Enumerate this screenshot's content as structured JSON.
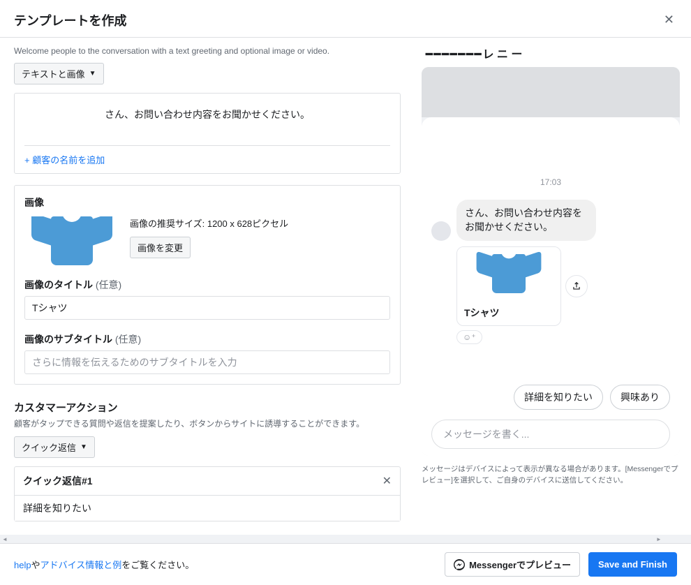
{
  "header": {
    "title": "テンプレートを作成"
  },
  "intro": "Welcome people to the conversation with a text greeting and optional image or video.",
  "contentTypeDropdown": "テキストと画像",
  "greeting": {
    "text": "さん、お問い合わせ内容をお聞かせください。",
    "addName": "+ 顧客の名前を追加"
  },
  "image": {
    "label": "画像",
    "hint": "画像の推奨サイズ: 1200 x 628ピクセル",
    "changeBtn": "画像を変更",
    "titleLabel": "画像のタイトル",
    "titleOptional": "(任意)",
    "titleValue": "Tシャツ",
    "subtitleLabel": "画像のサブタイトル",
    "subtitleOptional": "(任意)",
    "subtitlePlaceholder": "さらに情報を伝えるためのサブタイトルを入力"
  },
  "customerAction": {
    "title": "カスタマーアクション",
    "desc": "顧客がタップできる質問や返信を提案したり、ボタンからサイトに誘導することができます。",
    "dropdown": "クイック返信",
    "qr1": {
      "title": "クイック返信#1",
      "value": "詳細を知りたい"
    }
  },
  "preview": {
    "headerPartial": "レ ニ ー",
    "time": "17:03",
    "bubbleText": "さん、お問い合わせ内容をお聞かせください。",
    "cardTitle": "Tシャツ",
    "emojiAdd": "☺⁺",
    "quickReplies": [
      "詳細を知りたい",
      "興味あり"
    ],
    "composePlaceholder": "メッセージを書く...",
    "note": "メッセージはデバイスによって表示が異なる場合があります。[Messengerでプレビュー]を選択して、ご自身のデバイスに送信してください。"
  },
  "footer": {
    "help": "help",
    "and": "や",
    "advice": "アドバイス情報と例",
    "suffix": "をご覧ください。",
    "messengerBtn": "Messengerでプレビュー",
    "saveBtn": "Save and Finish"
  }
}
